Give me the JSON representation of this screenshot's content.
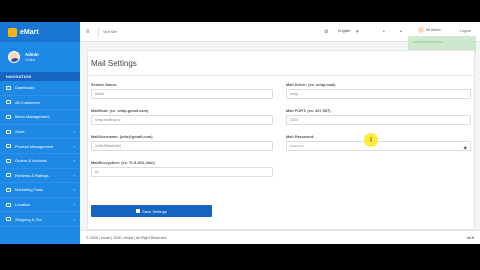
{
  "brand": {
    "name": "eMart"
  },
  "user": {
    "name": "Admin",
    "role": "Online"
  },
  "sidebar": {
    "heading": "NAVIGATION",
    "items": [
      {
        "label": "Dashboard",
        "chevron": ""
      },
      {
        "label": "All Customers",
        "chevron": ""
      },
      {
        "label": "Menu Management",
        "chevron": ""
      },
      {
        "label": "Store",
        "chevron": "‹"
      },
      {
        "label": "Product Management",
        "chevron": "‹"
      },
      {
        "label": "Orders & Invoices",
        "chevron": "‹"
      },
      {
        "label": "Reviews & Ratings",
        "chevron": "‹"
      },
      {
        "label": "Marketing Tools",
        "chevron": "‹"
      },
      {
        "label": "Location",
        "chevron": "‹"
      },
      {
        "label": "Shipping & Tax",
        "chevron": "‹"
      }
    ]
  },
  "topbar": {
    "visit_label": "Visit Site",
    "language": "English",
    "profile_label": "Hi! Admin",
    "logout_label": "Logout"
  },
  "page": {
    "title": "Mail Settings",
    "fields": {
      "sender_name": {
        "label": "Sender Name:",
        "value": "eMart"
      },
      "mail_driver": {
        "label": "Mail Driver: (ex. smtp,mail)",
        "value": "smtp"
      },
      "mail_host": {
        "label": "MailHost: (ex. smtp.gmail.com)",
        "value": "smtp.mailtrap.io"
      },
      "mail_port": {
        "label": "Mail PORT: (ex. 467,587)",
        "value": "2525"
      },
      "mail_username": {
        "label": "MailUsername: (info@gmail.com)",
        "value": "1e5fc9f5ba0dbd"
      },
      "mail_password": {
        "label": "Mail Password:",
        "value": "•••••••••••"
      },
      "mail_encryption": {
        "label": "MailEncryption: (ex. TLS,SSL,Null)",
        "value": "tls"
      }
    },
    "save_label": "Save Settings"
  },
  "footer": {
    "copyright": "© 2020 | emart | 2020, eMart | All Right Reserved",
    "version": "v2.0"
  },
  "colors": {
    "sidebar": "#1e88e5",
    "primary_button": "#1565c0",
    "cursor_highlight": "#ffeb3b"
  }
}
